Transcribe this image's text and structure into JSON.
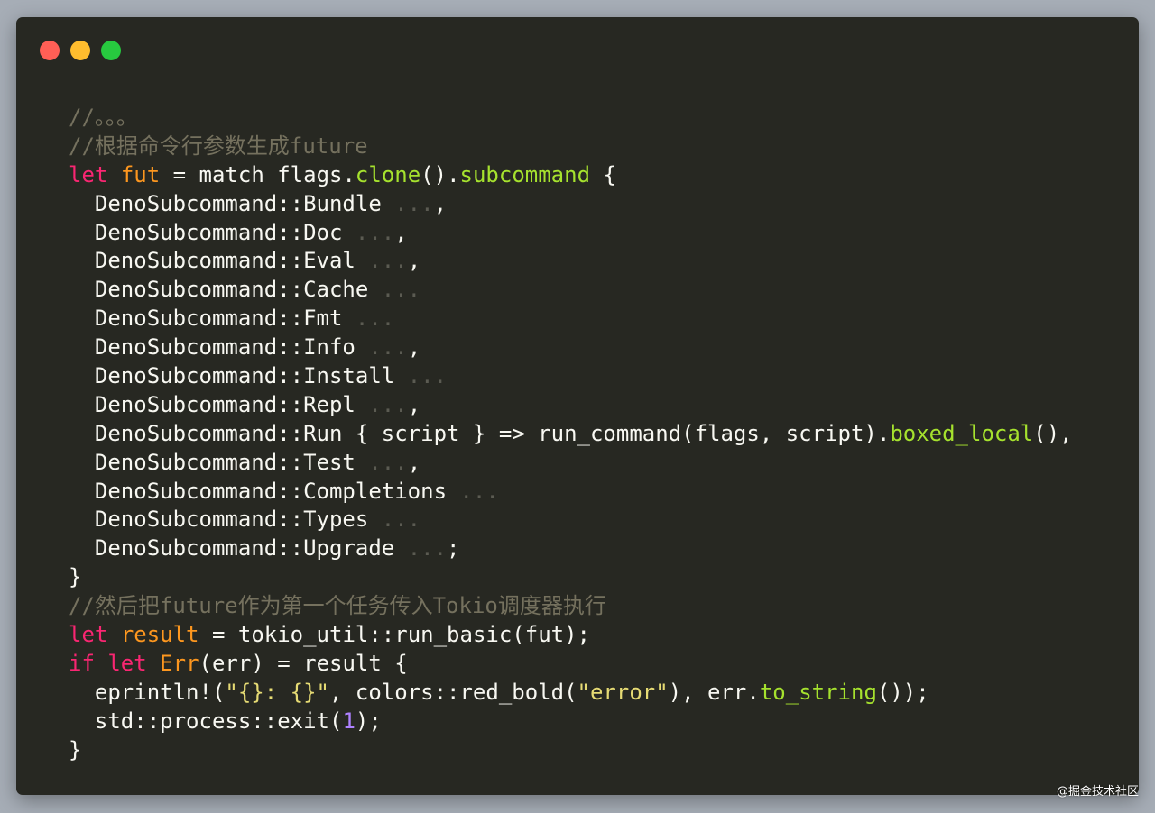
{
  "window": {
    "traffic_lights": [
      {
        "name": "close",
        "color": "#ff5f56"
      },
      {
        "name": "minimize",
        "color": "#ffbd2e"
      },
      {
        "name": "maximize",
        "color": "#27c93f"
      }
    ]
  },
  "code_lines": [
    [
      {
        "t": "//。。。",
        "c": "comment"
      }
    ],
    [
      {
        "t": "//根据命令行参数生成future",
        "c": "comment"
      }
    ],
    [
      {
        "t": "let",
        "c": "keyword"
      },
      {
        "t": " ",
        "c": "plain"
      },
      {
        "t": "fut",
        "c": "var"
      },
      {
        "t": " = match flags.",
        "c": "plain"
      },
      {
        "t": "clone",
        "c": "fn"
      },
      {
        "t": "().",
        "c": "plain"
      },
      {
        "t": "subcommand",
        "c": "fn"
      },
      {
        "t": " {",
        "c": "plain"
      }
    ],
    [
      {
        "t": "  DenoSubcommand::Bundle ",
        "c": "plain"
      },
      {
        "t": "...",
        "c": "dim"
      },
      {
        "t": ",",
        "c": "plain"
      }
    ],
    [
      {
        "t": "  DenoSubcommand::Doc ",
        "c": "plain"
      },
      {
        "t": "...",
        "c": "dim"
      },
      {
        "t": ",",
        "c": "plain"
      }
    ],
    [
      {
        "t": "  DenoSubcommand::Eval ",
        "c": "plain"
      },
      {
        "t": "...",
        "c": "dim"
      },
      {
        "t": ",",
        "c": "plain"
      }
    ],
    [
      {
        "t": "  DenoSubcommand::Cache ",
        "c": "plain"
      },
      {
        "t": "...",
        "c": "dim"
      }
    ],
    [
      {
        "t": "  DenoSubcommand::Fmt ",
        "c": "plain"
      },
      {
        "t": "...",
        "c": "dim"
      }
    ],
    [
      {
        "t": "  DenoSubcommand::Info ",
        "c": "plain"
      },
      {
        "t": "...",
        "c": "dim"
      },
      {
        "t": ",",
        "c": "plain"
      }
    ],
    [
      {
        "t": "  DenoSubcommand::Install ",
        "c": "plain"
      },
      {
        "t": "...",
        "c": "dim"
      }
    ],
    [
      {
        "t": "  DenoSubcommand::Repl ",
        "c": "plain"
      },
      {
        "t": "...",
        "c": "dim"
      },
      {
        "t": ",",
        "c": "plain"
      }
    ],
    [
      {
        "t": "  DenoSubcommand::Run { script } => run_command(flags, script).",
        "c": "plain"
      },
      {
        "t": "boxed_local",
        "c": "fn"
      },
      {
        "t": "(),",
        "c": "plain"
      }
    ],
    [
      {
        "t": "  DenoSubcommand::Test ",
        "c": "plain"
      },
      {
        "t": "...",
        "c": "dim"
      },
      {
        "t": ",",
        "c": "plain"
      }
    ],
    [
      {
        "t": "  DenoSubcommand::Completions ",
        "c": "plain"
      },
      {
        "t": "...",
        "c": "dim"
      }
    ],
    [
      {
        "t": "  DenoSubcommand::Types ",
        "c": "plain"
      },
      {
        "t": "...",
        "c": "dim"
      }
    ],
    [
      {
        "t": "  DenoSubcommand::Upgrade ",
        "c": "plain"
      },
      {
        "t": "...",
        "c": "dim"
      },
      {
        "t": ";",
        "c": "plain"
      }
    ],
    [
      {
        "t": "}",
        "c": "plain"
      }
    ],
    [
      {
        "t": "//然后把future作为第一个任务传入Tokio调度器执行",
        "c": "comment"
      }
    ],
    [
      {
        "t": "let",
        "c": "keyword"
      },
      {
        "t": " ",
        "c": "plain"
      },
      {
        "t": "result",
        "c": "var"
      },
      {
        "t": " = tokio_util::run_basic(fut);",
        "c": "plain"
      }
    ],
    [
      {
        "t": "if",
        "c": "keyword"
      },
      {
        "t": " ",
        "c": "plain"
      },
      {
        "t": "let",
        "c": "keyword"
      },
      {
        "t": " ",
        "c": "plain"
      },
      {
        "t": "Err",
        "c": "var"
      },
      {
        "t": "(err) = result {",
        "c": "plain"
      }
    ],
    [
      {
        "t": "  eprintln!(",
        "c": "plain"
      },
      {
        "t": "\"{}: {}\"",
        "c": "str"
      },
      {
        "t": ", colors::red_bold(",
        "c": "plain"
      },
      {
        "t": "\"error\"",
        "c": "str"
      },
      {
        "t": "), err.",
        "c": "plain"
      },
      {
        "t": "to_string",
        "c": "fn"
      },
      {
        "t": "());",
        "c": "plain"
      }
    ],
    [
      {
        "t": "  std::process::exit(",
        "c": "plain"
      },
      {
        "t": "1",
        "c": "num"
      },
      {
        "t": ");",
        "c": "plain"
      }
    ],
    [
      {
        "t": "}",
        "c": "plain"
      }
    ]
  ],
  "watermark": "@掘金技术社区"
}
